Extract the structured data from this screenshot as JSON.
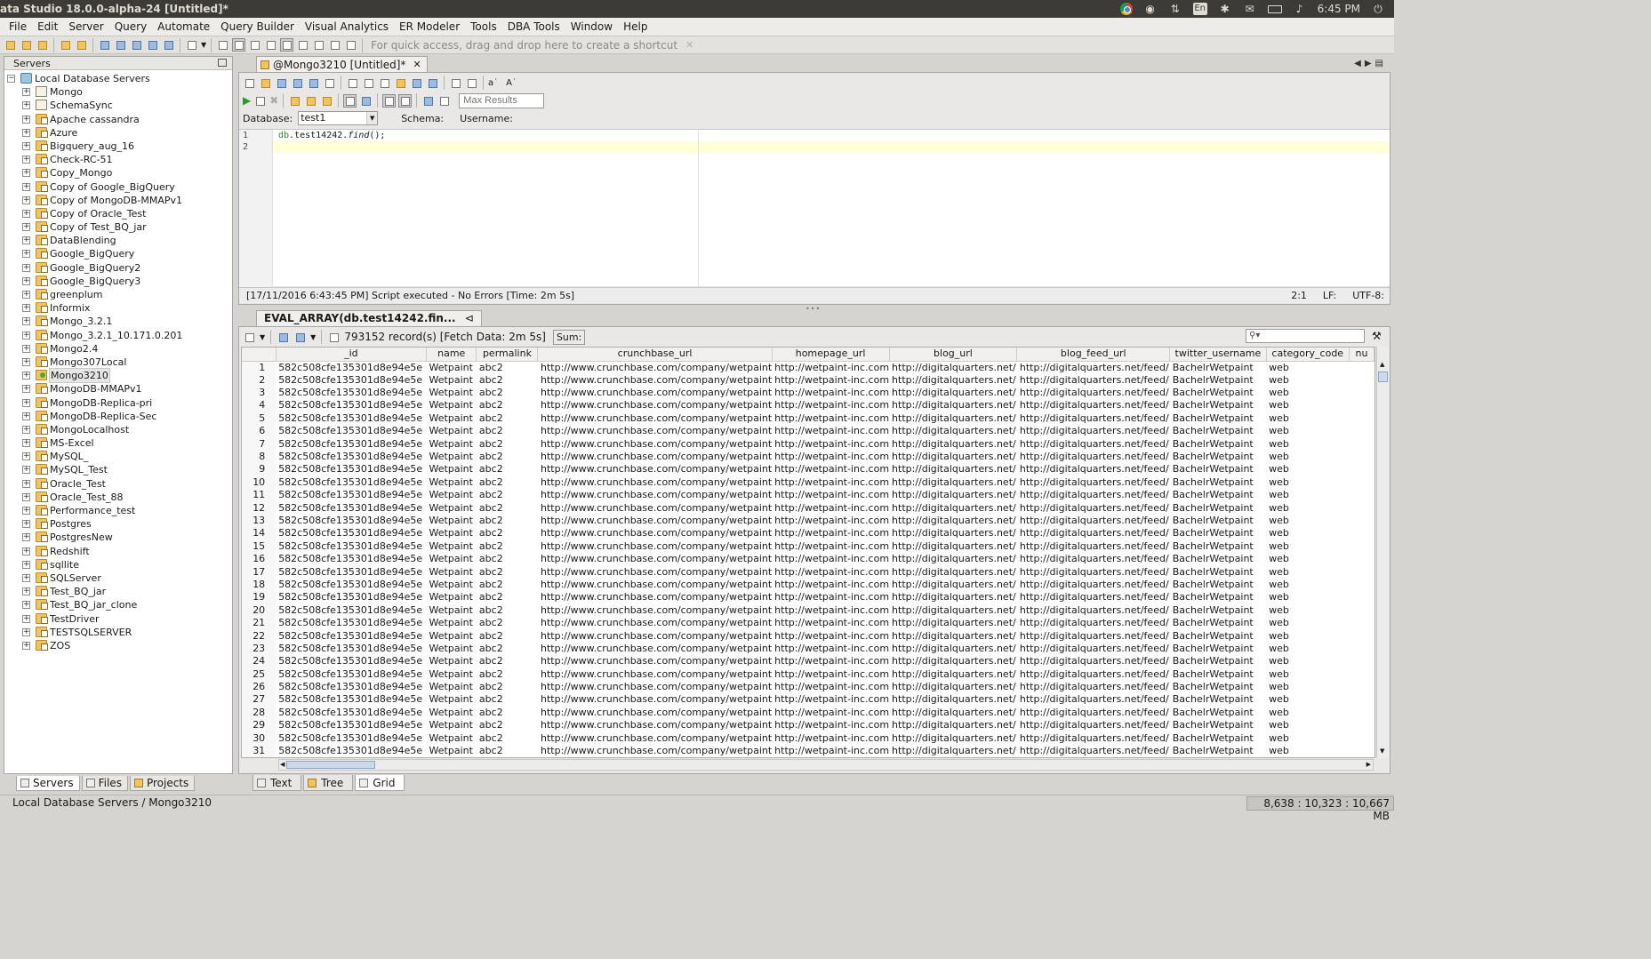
{
  "window": {
    "title": "ata Studio 18.0.0-alpha-24 [Untitled]*"
  },
  "tray": {
    "lang": "En",
    "time": "6:45 PM"
  },
  "menu": [
    "File",
    "Edit",
    "Server",
    "Query",
    "Automate",
    "Query Builder",
    "Visual Analytics",
    "ER Modeler",
    "Tools",
    "DBA Tools",
    "Window",
    "Help"
  ],
  "toolbar": {
    "shortcut_hint": "For quick access, drag and drop here to create a shortcut"
  },
  "left_panel": {
    "title": "Servers",
    "root": "Local Database Servers",
    "selected": "Mongo3210",
    "items": [
      "Mongo",
      "SchemaSync",
      "Apache cassandra",
      "Azure",
      "Bigquery_aug_16",
      "Check-RC-51",
      "Copy_Mongo",
      "Copy of Google_BigQuery",
      "Copy of MongoDB-MMAPv1",
      "Copy of Oracle_Test",
      "Copy of Test_BQ_jar",
      "DataBlending",
      "Google_BigQuery",
      "Google_BigQuery2",
      "Google_BigQuery3",
      "greenplum",
      "Informix",
      "Mongo_3.2.1",
      "Mongo_3.2.1_10.171.0.201",
      "Mongo2.4",
      "Mongo307Local",
      "Mongo3210",
      "MongoDB-MMAPv1",
      "MongoDB-Replica-pri",
      "MongoDB-Replica-Sec",
      "MongoLocalhost",
      "MS-Excel",
      "MySQL_",
      "MySQL_Test",
      "Oracle_Test",
      "Oracle_Test_88",
      "Performance_test",
      "Postgres",
      "PostgresNew",
      "Redshift",
      "sqllite",
      "SQLServer",
      "Test_BQ_jar",
      "Test_BQ_jar_clone",
      "TestDriver",
      "TESTSQLSERVER",
      "ZOS"
    ],
    "tabs": [
      "Servers",
      "Files",
      "Projects"
    ]
  },
  "editor": {
    "tab_label": "@Mongo3210 [Untitled]*",
    "max_results_placeholder": "Max Results",
    "database_label": "Database:",
    "database_value": "test1",
    "schema_label": "Schema:",
    "username_label": "Username:",
    "line_numbers": [
      "1",
      "2"
    ],
    "code_obj": "db",
    "code_mid": ".test14242.",
    "code_fn": "find",
    "code_end": "();",
    "status": "[17/11/2016 6:43:45 PM] Script executed - No Errors [Time: 2m 5s]",
    "cursor_pos": "2:1",
    "line_ending": "LF:",
    "encoding": "UTF-8:"
  },
  "results": {
    "tab_label": "EVAL_ARRAY(db.test14242.fin...",
    "record_info": "793152 record(s) [Fetch Data: 2m 5s]",
    "sum_label": "Sum:",
    "columns": [
      "",
      "_id",
      "name",
      "permalink",
      "crunchbase_url",
      "homepage_url",
      "blog_url",
      "blog_feed_url",
      "twitter_username",
      "category_code",
      "nu"
    ],
    "row_template": [
      "582c508cfe135301d8e94e5e",
      "Wetpaint",
      "abc2",
      "http://www.crunchbase.com/company/wetpaint",
      "http://wetpaint-inc.com",
      "http://digitalquarters.net/",
      "http://digitalquarters.net/feed/",
      "BachelrWetpaint",
      "web",
      ""
    ],
    "row_count_visible": 31,
    "bottom_tabs": [
      "Text",
      "Tree",
      "Grid"
    ]
  },
  "statusbar": {
    "path": "Local Database Servers / Mongo3210",
    "memory": "8,638 : 10,323 : 10,667 MB"
  }
}
